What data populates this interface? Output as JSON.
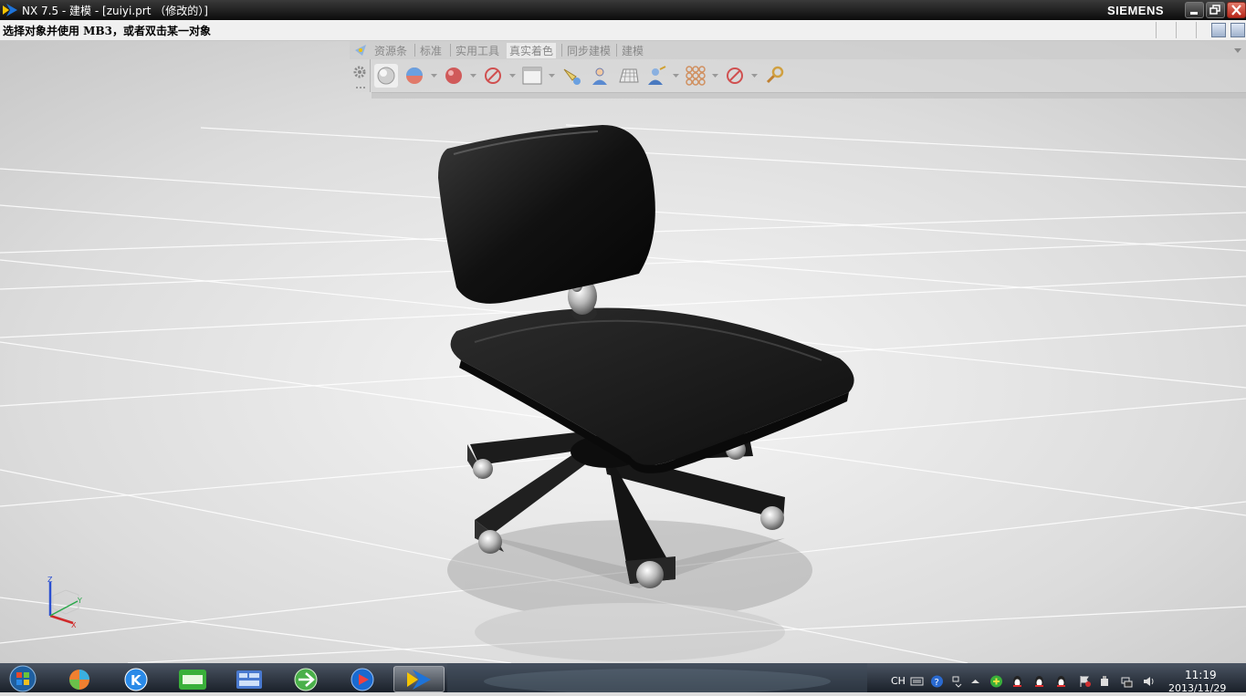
{
  "window": {
    "title": "NX 7.5 - 建模 - [zuiyi.prt （修改的）]",
    "brand": "SIEMENS",
    "controls": [
      "minimize",
      "restore",
      "close"
    ]
  },
  "status": {
    "prompt": "选择对象并使用 MB3，或者双击某一对象"
  },
  "ribbon": {
    "tabs": [
      {
        "label": "资源条",
        "active": false
      },
      {
        "label": "标准",
        "active": false
      },
      {
        "label": "实用工具",
        "active": false
      },
      {
        "label": "真实着色",
        "active": true
      },
      {
        "label": "同步建模",
        "active": false
      },
      {
        "label": "建模",
        "active": false
      }
    ],
    "tools": [
      "true-shading-icon",
      "material-sphere-icon",
      "global-material-icon",
      "disable-icon",
      "background-icon",
      "pick-light-icon",
      "person-icon",
      "grid-floor-icon",
      "user-light-icon",
      "multi-light-icon",
      "disable-icon",
      "settings-icon"
    ]
  },
  "viewport": {
    "model": "office-chair",
    "triad_axes": [
      "Z",
      "Y",
      "X"
    ]
  },
  "taskbar": {
    "apps": [
      "start-orb",
      "pinwheel-app",
      "kugou-app",
      "iqiyi-app",
      "file-manager-app",
      "green-refresh-app",
      "media-player-app",
      "nx-app"
    ],
    "tray": {
      "lang": "CH",
      "time": "11:19",
      "date": "2013/11/29"
    }
  },
  "colors": {
    "titlebar": "#1a1a1a",
    "chair": "#1c1c1c",
    "floor": "#d9d9d9",
    "close_button": "#c43c2c",
    "taskbar": "#2a313b"
  }
}
